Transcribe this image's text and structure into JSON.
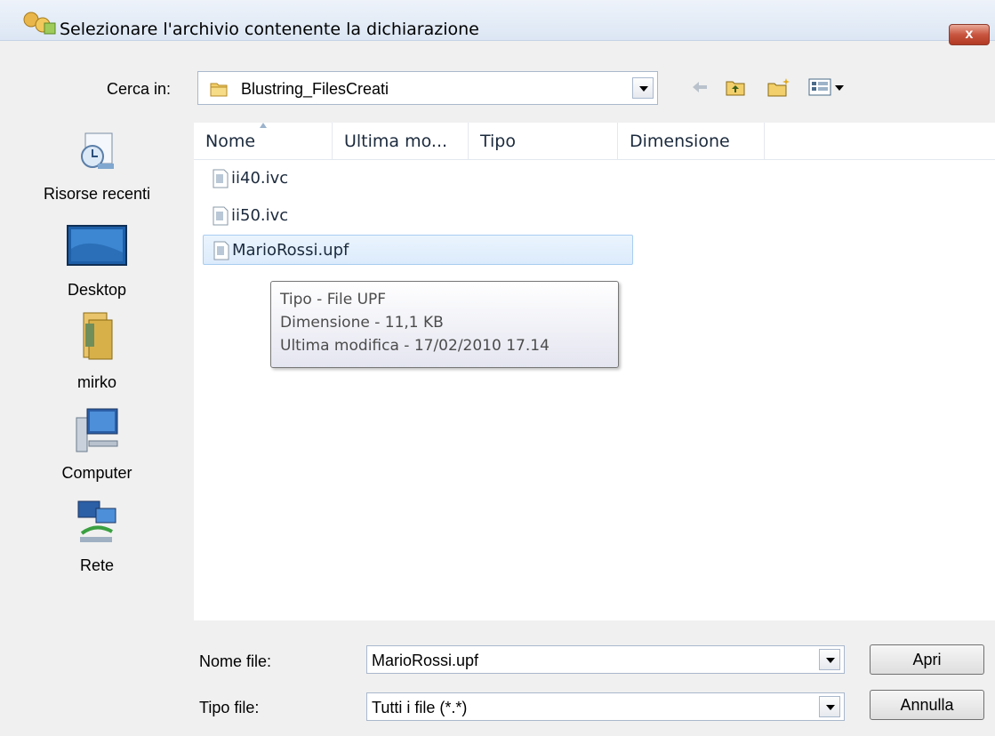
{
  "window": {
    "title": "Selezionare l'archivio contenente la dichiarazione",
    "close_label": "x"
  },
  "lookin": {
    "label": "Cerca in:",
    "value": "Blustring_FilesCreati"
  },
  "toolbar": {
    "icons": [
      "back-icon",
      "up-folder-icon",
      "new-folder-icon",
      "views-menu-icon"
    ]
  },
  "places": [
    {
      "label": "Risorse recenti",
      "icon": "recent-places-icon"
    },
    {
      "label": "Desktop",
      "icon": "desktop-icon"
    },
    {
      "label": "mirko",
      "icon": "user-folder-icon"
    },
    {
      "label": "Computer",
      "icon": "computer-icon"
    },
    {
      "label": "Rete",
      "icon": "network-icon"
    }
  ],
  "columns": [
    "Nome",
    "Ultima mo...",
    "Tipo",
    "Dimensione"
  ],
  "files": [
    {
      "name": "ii40.ivc",
      "selected": false
    },
    {
      "name": "ii50.ivc",
      "selected": false
    },
    {
      "name": "MarioRossi.upf",
      "selected": true
    }
  ],
  "tooltip": {
    "type": "Tipo - File UPF",
    "size": "Dimensione - 11,1 KB",
    "modified": "Ultima modifica - 17/02/2010 17.14"
  },
  "bottom": {
    "filename_label": "Nome file:",
    "filename_value": "MarioRossi.upf",
    "filetype_label": "Tipo file:",
    "filetype_value": "Tutti i file (*.*)",
    "open_label": "Apri",
    "cancel_label": "Annulla"
  },
  "colors": {
    "selection": "#dcebfc",
    "selection_border": "#a9cdf0",
    "close_button": "#c8553f"
  }
}
